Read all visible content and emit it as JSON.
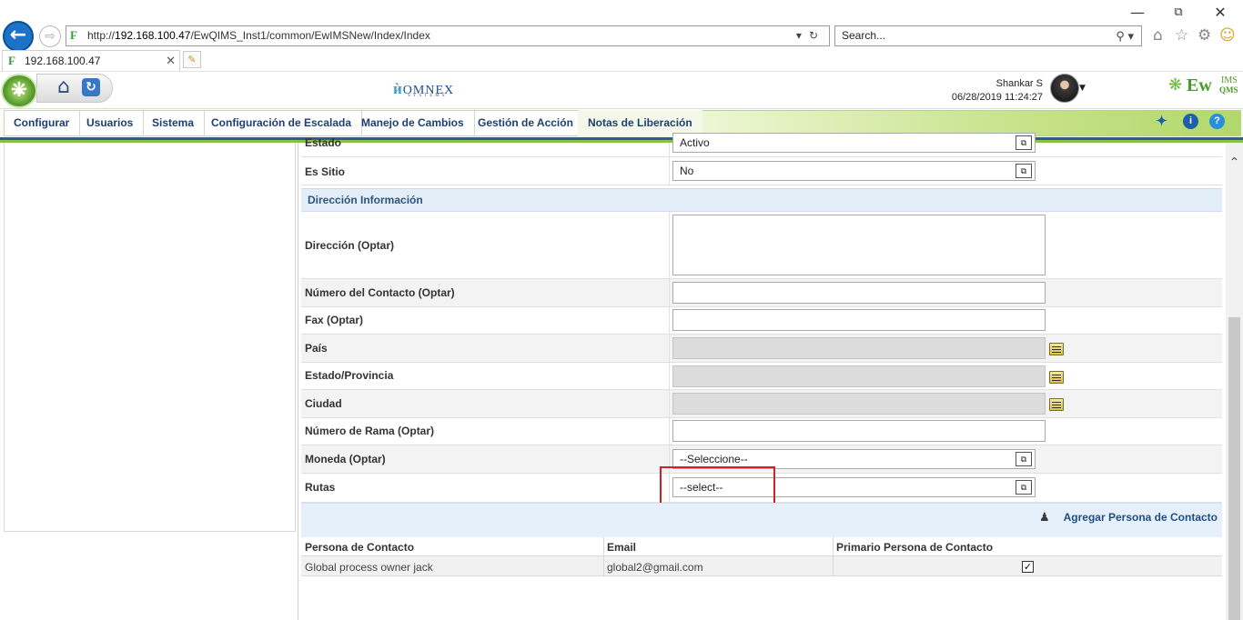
{
  "browser": {
    "url_prefix": "http://",
    "url_host": "192.168.100.47",
    "url_path": "/EwQIMS_Inst1/common/EwIMSNew/Index/Index",
    "search_placeholder": "Search...",
    "tab_title": "192.168.100.47",
    "window_controls": [
      "minimize-icon",
      "restore-icon",
      "close-icon"
    ]
  },
  "header": {
    "brand_logo": "OMNEX",
    "brand_sub": "SYSTEMS",
    "user_name": "Shankar S",
    "datetime": "06/28/2019 11:24:27",
    "product_logo_ew": "Ew",
    "product_logo_ims": "IMS",
    "product_logo_qms": "QMS"
  },
  "menu": {
    "items": [
      "Configurar",
      "Usuarios",
      "Sistema",
      "Configuración de Escalada",
      "Manejo de Cambios",
      "Gestión de Acción",
      "Notas de Liberación"
    ],
    "tool_icons": [
      "pin-icon",
      "info-icon",
      "help-icon"
    ]
  },
  "form": {
    "estado_label": "Estado",
    "estado_value": "Activo",
    "es_sitio_label": "Es Sitio",
    "es_sitio_value": "No",
    "section_title": "Dirección Información",
    "direccion_label": "Dirección (Optar)",
    "numero_contacto_label": "Número del Contacto (Optar)",
    "fax_label": "Fax (Optar)",
    "pais_label": "País",
    "estado_provincia_label": "Estado/Provincia",
    "ciudad_label": "Ciudad",
    "numero_rama_label": "Número de Rama (Optar)",
    "moneda_label": "Moneda (Optar)",
    "moneda_value": "--Seleccione--",
    "rutas_label": "Rutas",
    "rutas_value": "--select--"
  },
  "contacts": {
    "add_button": "Agregar Persona de Contacto",
    "columns": [
      "Persona de Contacto",
      "Email",
      "Primario Persona de Contacto"
    ],
    "rows": [
      {
        "persona": "Global process owner jack",
        "email": "global2@gmail.com",
        "primario": true
      }
    ]
  },
  "colors": {
    "menu_text": "#1d3f74",
    "accent_blue": "#2d5c96",
    "accent_green": "#8ac043",
    "highlight": "#d22020"
  }
}
